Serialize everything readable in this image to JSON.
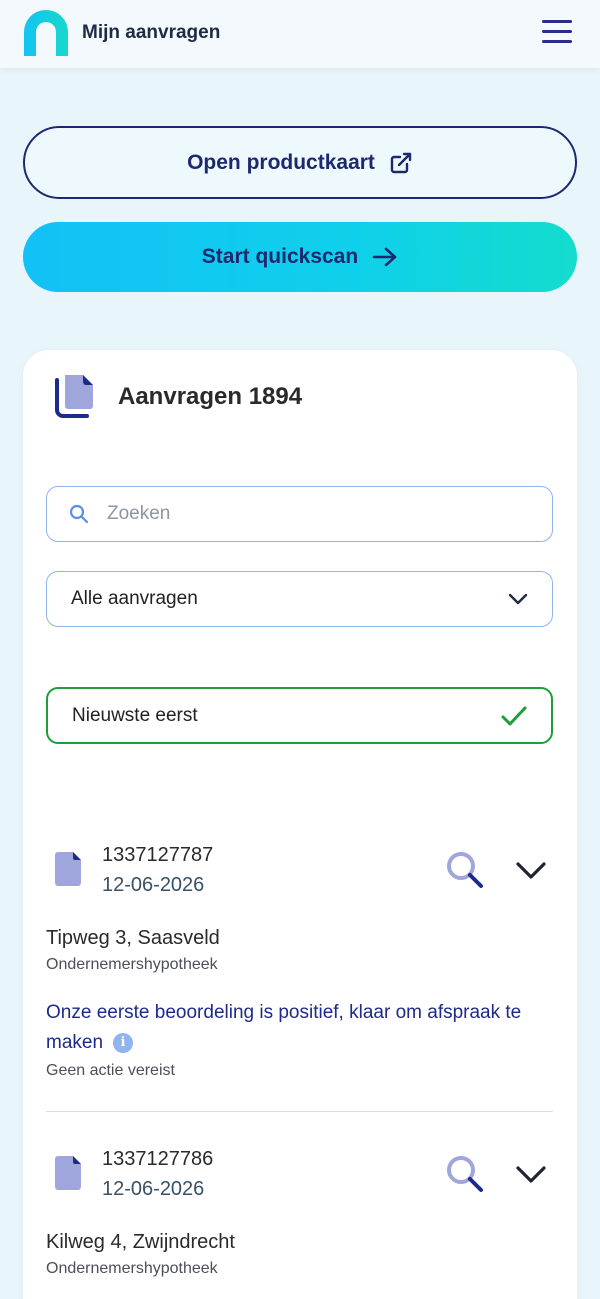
{
  "header": {
    "app_title": "Mijn aanvragen",
    "logo_icon": "brand-logo",
    "menu_icon": "hamburger-menu-icon"
  },
  "actions": {
    "open_productkaart_label": "Open productkaart",
    "open_productkaart_icon": "external-link-icon",
    "start_quickscan_label": "Start quickscan",
    "start_quickscan_icon": "arrow-right-icon"
  },
  "card": {
    "title": "Aanvragen 1894",
    "icon": "copy-documents-icon",
    "search": {
      "placeholder": "Zoeken",
      "value": ""
    },
    "filter": {
      "selected": "Alle aanvragen"
    },
    "sort": {
      "selected": "Nieuwste eerst"
    }
  },
  "items": [
    {
      "number": "1337127787",
      "date": "12-06-2026",
      "address": "Tipweg 3, Saasveld",
      "type": "Ondernemershypotheek",
      "status": "Onze eerste beoordeling is positief, klaar om afspraak te maken",
      "action": "Geen actie vereist"
    },
    {
      "number": "1337127786",
      "date": "12-06-2026",
      "address": "Kilweg 4, Zwijndrecht",
      "type": "Ondernemershypotheek"
    }
  ],
  "colors": {
    "navy": "#1c2970",
    "accent_gradient_start": "#12c1f6",
    "accent_gradient_end": "#14dccd",
    "success_green": "#1e9e3a",
    "input_border": "#8fb4ef"
  }
}
